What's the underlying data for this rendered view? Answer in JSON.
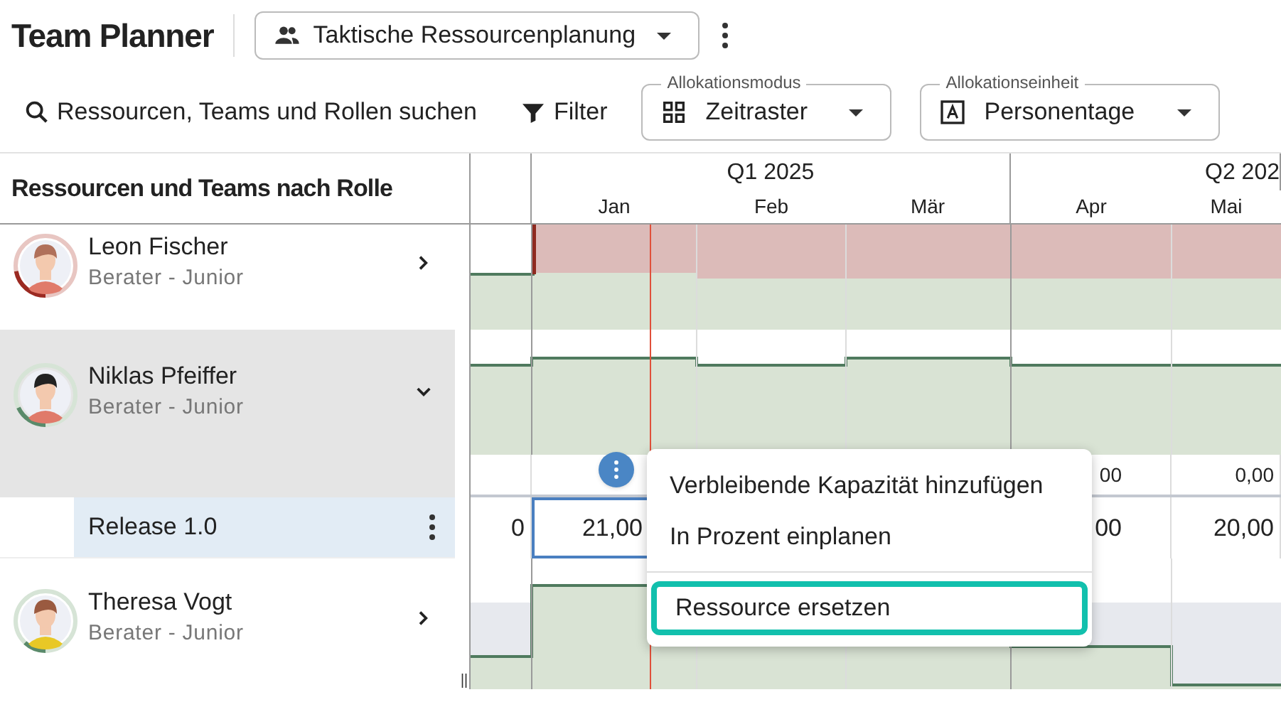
{
  "app_title": "Team Planner",
  "view_selector": {
    "label": "Taktische Ressourcenplanung"
  },
  "toolbar": {
    "search": {
      "label": "Ressourcen, Teams und Rollen suchen"
    },
    "filter": {
      "label": "Filter"
    },
    "selects": [
      {
        "kind": "grid",
        "label": "Allokationsmodus",
        "value": "Zeitraster"
      },
      {
        "kind": "unit",
        "label": "Allokationseinheit",
        "value": "Personentage"
      }
    ]
  },
  "table": {
    "heading": "Ressourcen und Teams nach Rolle",
    "quarters": [
      {
        "label": "Q1 2025"
      },
      {
        "label": "Q2 202"
      }
    ],
    "months": [
      "Jan",
      "Feb",
      "Mär",
      "Apr",
      "Mai"
    ],
    "resources": [
      {
        "name": "Leon Fischer",
        "role": "Berater - Junior",
        "color": "#9b2a22",
        "expanded": false
      },
      {
        "name": "Niklas Pfeiffer",
        "role": "Berater - Junior",
        "color": "#5a8a6a",
        "expanded": true,
        "totals": {
          "trailing_cells": [
            {
              "value": "00"
            },
            {
              "value": "0,00"
            }
          ]
        },
        "children": [
          {
            "name": "Release 1.0",
            "leading_cells": [
              {
                "value": "0",
                "selected": false
              },
              {
                "value": "21,00",
                "selected": true
              }
            ],
            "trailing_cells": [
              {
                "value": "00",
                "selected": false
              },
              {
                "value": "20,00",
                "selected": false
              }
            ]
          }
        ]
      },
      {
        "name": "Theresa Vogt",
        "role": "Berater - Junior",
        "color": "#5a8a6a",
        "expanded": false
      }
    ]
  },
  "context_menu": {
    "items": [
      {
        "label": "Verbleibende Kapazität hinzufügen",
        "selected": false
      },
      {
        "label": "In Prozent einplanen",
        "selected": false
      },
      {
        "label": "Ressource ersetzen",
        "selected": true
      }
    ]
  }
}
